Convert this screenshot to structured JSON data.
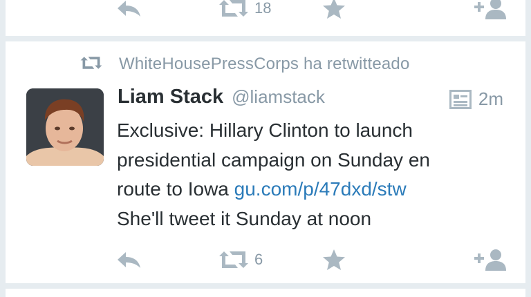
{
  "top_tweet": {
    "retweet_count": "18"
  },
  "tweet": {
    "retweeted_by": "WhiteHousePressCorps ha retwitteado",
    "author_name": "Liam Stack",
    "author_handle": "@liamstack",
    "time": "2m",
    "text_lines": [
      "Exclusive: Hillary Clinton to launch",
      "presidential campaign on Sunday en",
      "route to Iowa "
    ],
    "link": "gu.com/p/47dxd/stw",
    "text_last_line": "She'll tweet it Sunday at noon",
    "retweet_count": "6"
  },
  "colors": {
    "link": "#2b7bb9",
    "muted": "#8899a6",
    "icon": "#aab8c2",
    "text": "#292f33",
    "background": "#e6ecf0"
  }
}
